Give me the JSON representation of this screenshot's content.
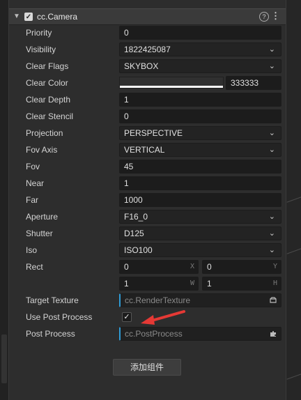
{
  "component": {
    "title": "cc.Camera",
    "more_glyph": "⋮",
    "help_glyph": "?"
  },
  "props": {
    "priority": {
      "label": "Priority",
      "value": "0"
    },
    "visibility": {
      "label": "Visibility",
      "value": "1822425087"
    },
    "clear_flags": {
      "label": "Clear Flags",
      "value": "SKYBOX"
    },
    "clear_color": {
      "label": "Clear Color",
      "hex": "333333",
      "swatch": "#ffffff"
    },
    "clear_depth": {
      "label": "Clear Depth",
      "value": "1"
    },
    "clear_stencil": {
      "label": "Clear Stencil",
      "value": "0"
    },
    "projection": {
      "label": "Projection",
      "value": "PERSPECTIVE"
    },
    "fov_axis": {
      "label": "Fov Axis",
      "value": "VERTICAL"
    },
    "fov": {
      "label": "Fov",
      "value": "45"
    },
    "near": {
      "label": "Near",
      "value": "1"
    },
    "far": {
      "label": "Far",
      "value": "1000"
    },
    "aperture": {
      "label": "Aperture",
      "value": "F16_0"
    },
    "shutter": {
      "label": "Shutter",
      "value": "D125"
    },
    "iso": {
      "label": "Iso",
      "value": "ISO100"
    },
    "rect": {
      "label": "Rect",
      "x": "0",
      "y": "0",
      "w": "1",
      "h": "1",
      "x_axis": "X",
      "y_axis": "Y",
      "w_axis": "W",
      "h_axis": "H"
    },
    "target_texture": {
      "label": "Target Texture",
      "placeholder": "cc.RenderTexture"
    },
    "use_post_process": {
      "label": "Use Post Process",
      "checked": true,
      "check_glyph": "✓"
    },
    "post_process": {
      "label": "Post Process",
      "placeholder": "cc.PostProcess"
    }
  },
  "add_component_label": "添加组件",
  "icons": {
    "caret": "chevron-down-icon",
    "asset": "folder-icon",
    "puzzle": "puzzle-icon"
  },
  "colors": {
    "accent": "#2f9bd6",
    "annotation": "#e53935"
  }
}
